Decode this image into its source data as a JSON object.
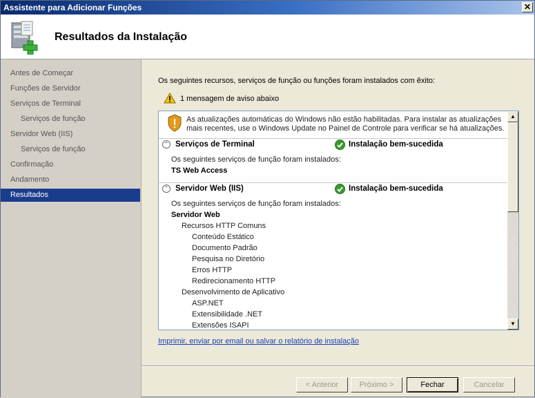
{
  "window": {
    "title": "Assistente para Adicionar Funções",
    "close_glyph": "✕"
  },
  "header": {
    "title": "Resultados da Instalação",
    "icon": "server-add-icon"
  },
  "sidebar": {
    "items": [
      {
        "label": "Antes de Começar"
      },
      {
        "label": "Funções de Servidor"
      },
      {
        "label": "Serviços de Terminal"
      },
      {
        "label": "Serviços de função"
      },
      {
        "label": "Servidor Web (IIS)"
      },
      {
        "label": "Serviços de função"
      },
      {
        "label": "Confirmação"
      },
      {
        "label": "Andamento"
      },
      {
        "label": "Resultados"
      }
    ],
    "active_color": "#1a3c8d"
  },
  "main": {
    "intro": "Os seguintes recursos, serviços de função ou funções foram instalados com êxito:",
    "warning": "1 mensagem de aviso abaixo",
    "update_message": "As atualizações automáticas do Windows não estão habilitadas. Para instalar as atualizações mais recentes, use o Windows Update no Painel de Controle para verificar se há atualizações.",
    "sections": [
      {
        "title": "Serviços de Terminal",
        "status": "Instalação bem-sucedida",
        "intro": "Os seguintes serviços de função foram instalados:",
        "items": [
          "TS Web Access"
        ]
      },
      {
        "title": "Servidor Web (IIS)",
        "status": "Instalação bem-sucedida",
        "intro": "Os seguintes serviços de função foram instalados:",
        "root": "Servidor Web",
        "groups": [
          {
            "label": "Recursos HTTP Comuns",
            "items": [
              "Conteúdo Estático",
              "Documento Padrão",
              "Pesquisa no Diretório",
              "Erros HTTP",
              "Redirecionamento HTTP"
            ]
          },
          {
            "label": "Desenvolvimento de Aplicativo",
            "items": [
              "ASP.NET",
              "Extensibilidade .NET",
              "Extensões ISAPI"
            ]
          }
        ]
      }
    ],
    "link": "Imprimir, enviar por email ou salvar o relatório de instalação",
    "success_color": "#3a9a2e"
  },
  "footer": {
    "back": "< Anterior",
    "next": "Próximo >",
    "close": "Fechar",
    "cancel": "Cancelar"
  }
}
